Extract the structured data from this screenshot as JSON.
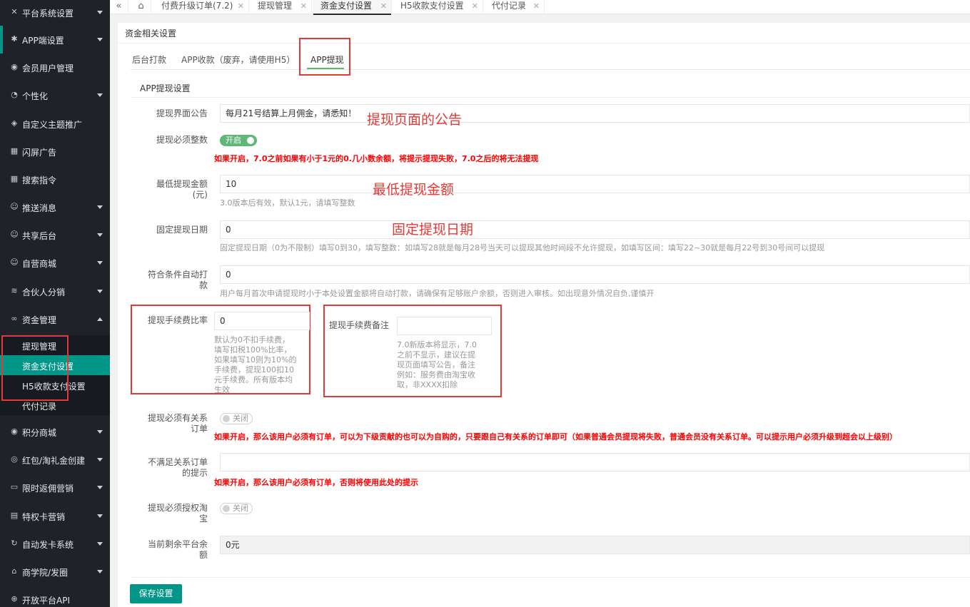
{
  "sidebar": {
    "items": [
      {
        "label": "平台系统设置",
        "icon": "wrench-icon",
        "glyph": "✕",
        "arrow": "down"
      },
      {
        "label": "APP端设置",
        "icon": "gear-icon",
        "glyph": "✱",
        "arrow": "down"
      },
      {
        "label": "会员用户管理",
        "icon": "shield-icon",
        "glyph": "◉",
        "arrow": ""
      },
      {
        "label": "个性化",
        "icon": "palette-icon",
        "glyph": "◔",
        "arrow": "down"
      },
      {
        "label": "自定义主题推广",
        "icon": "cube-icon",
        "glyph": "◈",
        "arrow": ""
      },
      {
        "label": "闪屏广告",
        "icon": "apps-icon",
        "glyph": "▦",
        "arrow": ""
      },
      {
        "label": "搜索指令",
        "icon": "apps-icon",
        "glyph": "▦",
        "arrow": ""
      },
      {
        "label": "推送消息",
        "icon": "user-icon",
        "glyph": "☺",
        "arrow": "down"
      },
      {
        "label": "共享后台",
        "icon": "user-icon",
        "glyph": "☺",
        "arrow": "down"
      },
      {
        "label": "自营商城",
        "icon": "user-icon",
        "glyph": "☺",
        "arrow": "down"
      },
      {
        "label": "合伙人分销",
        "icon": "layers-icon",
        "glyph": "≋",
        "arrow": "down"
      },
      {
        "label": "资金管理",
        "icon": "link-icon",
        "glyph": "∞",
        "arrow": "up"
      }
    ],
    "subitems": [
      {
        "label": "提现管理"
      },
      {
        "label": "资金支付设置"
      },
      {
        "label": "H5收款支付设置"
      },
      {
        "label": "代付记录"
      }
    ],
    "items_after": [
      {
        "label": "积分商城",
        "icon": "shield-icon",
        "glyph": "◉",
        "arrow": "down"
      },
      {
        "label": "红包/淘礼金创建",
        "icon": "compass-icon",
        "glyph": "◎",
        "arrow": "down"
      },
      {
        "label": "限时返佣营销",
        "icon": "calendar-icon",
        "glyph": "▭",
        "arrow": "down"
      },
      {
        "label": "特权卡营销",
        "icon": "card-icon",
        "glyph": "▤",
        "arrow": "down"
      },
      {
        "label": "自动发卡系统",
        "icon": "cycle-icon",
        "glyph": "↻",
        "arrow": "down"
      },
      {
        "label": "商学院/发圈",
        "icon": "store-icon",
        "glyph": "⌂",
        "arrow": "down"
      },
      {
        "label": "开放平台API",
        "icon": "globe-icon",
        "glyph": "⊕",
        "arrow": ""
      }
    ]
  },
  "topbar": {
    "tabs": [
      {
        "label": "付费升级订单(7.2)"
      },
      {
        "label": "提现管理"
      },
      {
        "label": "资金支付设置"
      },
      {
        "label": "H5收款支付设置"
      },
      {
        "label": "代付记录"
      }
    ],
    "close_glyph": "✕",
    "collapse_glyph": "«",
    "home_glyph": "⌂"
  },
  "card": {
    "title": "资金相关设置",
    "tabs": [
      {
        "label": "后台打款"
      },
      {
        "label": "APP收款（废弃，请使用H5）"
      },
      {
        "label": "APP提现"
      }
    ],
    "section_title": "APP提现设置",
    "fields": {
      "notice": {
        "label": "提现界面公告",
        "value": "每月21号结算上月佣金，请悉知！"
      },
      "integer": {
        "label": "提现必须整数",
        "switch_text": "开启",
        "warn": "如果开启，7.0之前如果有小于1元的0.几小数余额，将提示提现失败，7.0之后的将无法提现"
      },
      "min_amount": {
        "label_line1": "最低提现金额",
        "label_line2": "(元)",
        "value": "10",
        "hint": "3.0版本后有效，默认1元，请填写整数"
      },
      "fixed_date": {
        "label": "固定提现日期",
        "value": "0",
        "hint": "固定提现日期（0为不限制）填写0到30，填写整数：如填写28就是每月28号当天可以提现其他时间段不允许提现，如填写区间：填写22~30就是每月22号到30号间可以提现"
      },
      "auto_pay": {
        "label_line1": "符合条件自动打",
        "label_line2": "款",
        "value": "0",
        "hint": "用户每月首次申请提现时小于本处设置金额将自动打款，请确保有足够账户余额，否则进入审核。如出现意外情况自负,谨慎开"
      },
      "fee_ratio": {
        "label": "提现手续费比率",
        "value": "0",
        "hint_lines": [
          "默认为0不扣手续费，",
          "填写扣税100%比率，",
          "如果填写10则为10%的",
          "手续费，提现100扣10",
          "元手续费。所有版本均",
          "生效"
        ]
      },
      "fee_remark": {
        "label": "提现手续费备注",
        "value": "",
        "hint_lines": [
          "7.0新版本将显示，7.0",
          "之前不显示，建议在提",
          "现页面填写公告，备注",
          "例如：服务费由淘宝收",
          "取，非XXXX扣除"
        ]
      },
      "must_order": {
        "label_line1": "提现必须有关系",
        "label_line2": "订单",
        "switch_text": "关闭",
        "warn": "如果开启，那么该用户必须有订单，可以为下级贡献的也可以为自购的，只要跟自己有关系的订单即可（如果普通会员提现将失败，普通会员没有关系订单。可以提示用户必须升级到超会以上级别）"
      },
      "order_tip": {
        "label_line1": "不满足关系订单",
        "label_line2": "的提示",
        "value": "",
        "warn": "如果开启，那么该用户必须有订单，否则将使用此处的提示"
      },
      "taobao_auth": {
        "label_line1": "提现必须授权淘",
        "label_line2": "宝",
        "switch_text": "关闭"
      },
      "balance": {
        "label_line1": "当前剩余平台余",
        "label_line2": "额",
        "value": "0元"
      }
    },
    "save_label": "保存设置"
  },
  "annotations": {
    "notice": "提现页面的公告",
    "min_amount": "最低提现金额",
    "fixed_date": "固定提现日期"
  },
  "colors": {
    "sidebar_bg": "#20222a",
    "accent": "#009688",
    "switch_on": "#5fb878",
    "warn": "#ff0000",
    "annotation": "#e53935"
  }
}
